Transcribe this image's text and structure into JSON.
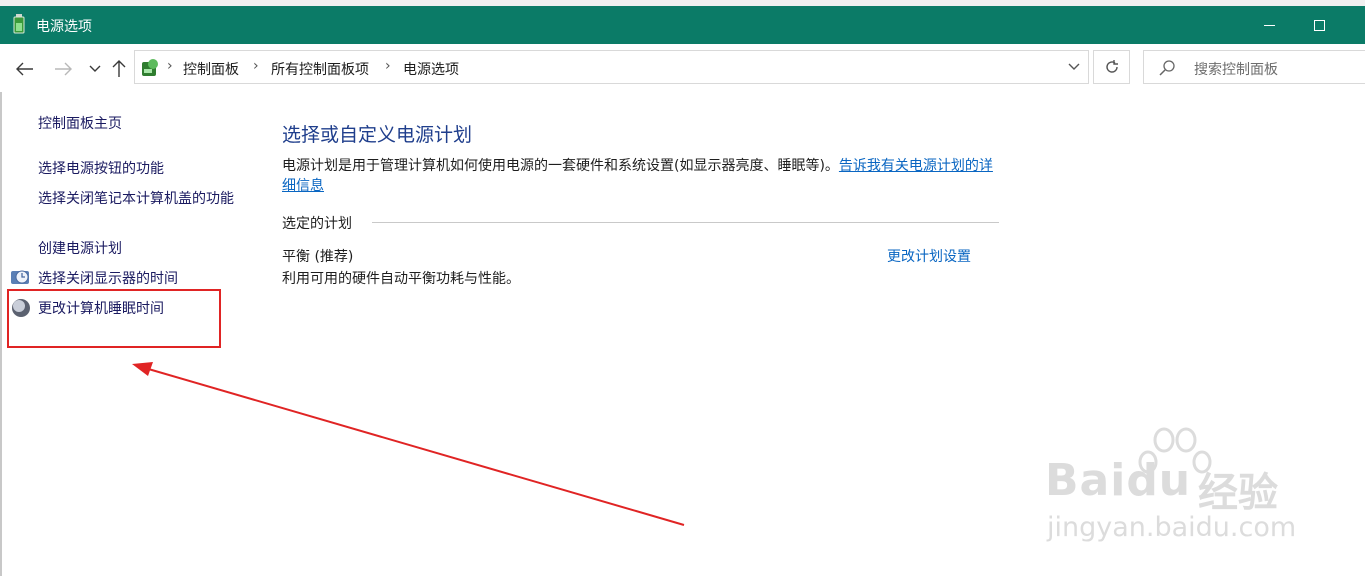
{
  "window": {
    "title": "电源选项",
    "colors": {
      "titlebar": "#0b7b67",
      "link": "#0a66c2",
      "heading": "#1f3e8c",
      "annotation": "#e02424"
    }
  },
  "nav": {
    "breadcrumb": [
      "控制面板",
      "所有控制面板项",
      "电源选项"
    ],
    "search_placeholder": "搜索控制面板"
  },
  "sidebar": {
    "items": [
      {
        "label": "控制面板主页"
      },
      {
        "label": "选择电源按钮的功能"
      },
      {
        "label": "选择关闭笔记本计算机盖的功能"
      },
      {
        "label": "创建电源计划"
      },
      {
        "label": "选择关闭显示器的时间",
        "icon": "monitor-clock-icon"
      },
      {
        "label": "更改计算机睡眠时间",
        "icon": "moon-sleep-icon"
      }
    ]
  },
  "main": {
    "title": "选择或自定义电源计划",
    "description": "电源计划是用于管理计算机如何使用电源的一套硬件和系统设置(如显示器亮度、睡眠等)。",
    "learn_more_link": "告诉我有关电源计划的详细信息",
    "section_label": "选定的计划",
    "plan": {
      "name": "平衡 (推荐)",
      "description": "利用可用的硬件自动平衡功耗与性能。",
      "settings_link": "更改计划设置"
    }
  },
  "watermark": {
    "brand": "Bai",
    "brand_suffix": "du",
    "brand_cn": "经验",
    "url": "jingyan.baidu.com"
  }
}
